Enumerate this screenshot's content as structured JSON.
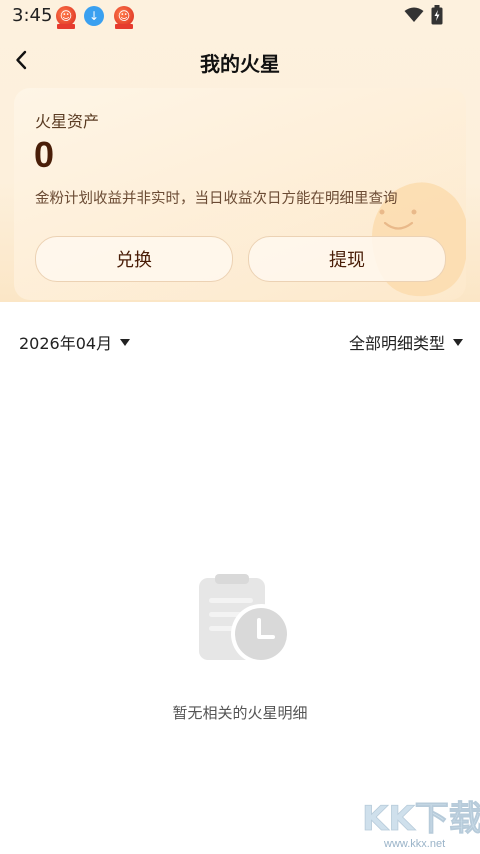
{
  "status_bar": {
    "time": "3:45",
    "notifications": [
      "app-red-icon",
      "download-icon",
      "app-red-icon"
    ]
  },
  "nav": {
    "back_icon": "chevron-left-icon",
    "title": "我的火星"
  },
  "asset_card": {
    "label": "火星资产",
    "value": "0",
    "note": "金粉计划收益并非实时，当日收益次日方能在明细里查询",
    "exchange_button": "兑换",
    "withdraw_button": "提现"
  },
  "filters": {
    "date": "2026年04月",
    "type": "全部明细类型"
  },
  "empty_state": {
    "icon": "clipboard-clock-icon",
    "text": "暂无相关的火星明细"
  },
  "watermark": {
    "logo_text": "KK下载",
    "url": "www.kkx.net"
  },
  "colors": {
    "header_bg": "#fdf1de",
    "accent_text": "#4a1e08",
    "button_border": "#ecd2b4",
    "empty_icon": "#e4e4e4"
  }
}
